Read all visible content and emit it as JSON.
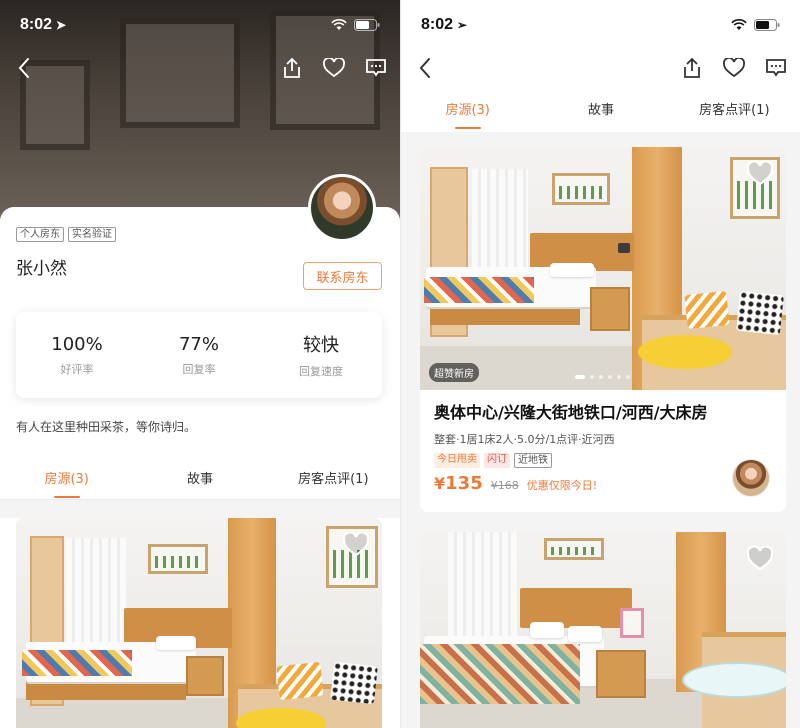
{
  "status_bar": {
    "time": "8:02"
  },
  "tabs": [
    {
      "label": "房源(3)",
      "active": true
    },
    {
      "label": "故事",
      "active": false
    },
    {
      "label": "房客点评(1)",
      "active": false
    }
  ],
  "host": {
    "badges": [
      "个人房东",
      "实名验证"
    ],
    "name": "张小然",
    "contact_label": "联系房东",
    "stats": [
      {
        "value": "100%",
        "label": "好评率"
      },
      {
        "value": "77%",
        "label": "回复率"
      },
      {
        "value": "较快",
        "label": "回复速度"
      }
    ],
    "bio": "有人在这里种田采茶，等你诗归。"
  },
  "listing": {
    "badge": "超赞新房",
    "title": "奥体中心/兴隆大街地铁口/河西/大床房",
    "info": "整套·1居1床2人·5.0分/1点评·近河西",
    "tags": [
      "今日甩卖",
      "闪订",
      "近地铁"
    ],
    "price": {
      "currency": "¥",
      "now": "135",
      "original": "¥168",
      "promo": "优惠仅限今日!"
    },
    "carousel": {
      "count": 6,
      "active_index": 0
    }
  },
  "icons": [
    "back-icon",
    "share-icon",
    "favorite-heart-icon",
    "message-icon",
    "location-arrow-icon",
    "wifi-icon",
    "battery-icon"
  ],
  "colors": {
    "accent": "#ec7a3a",
    "promo_red": "#e9503d",
    "background": "#f4f4f4"
  }
}
